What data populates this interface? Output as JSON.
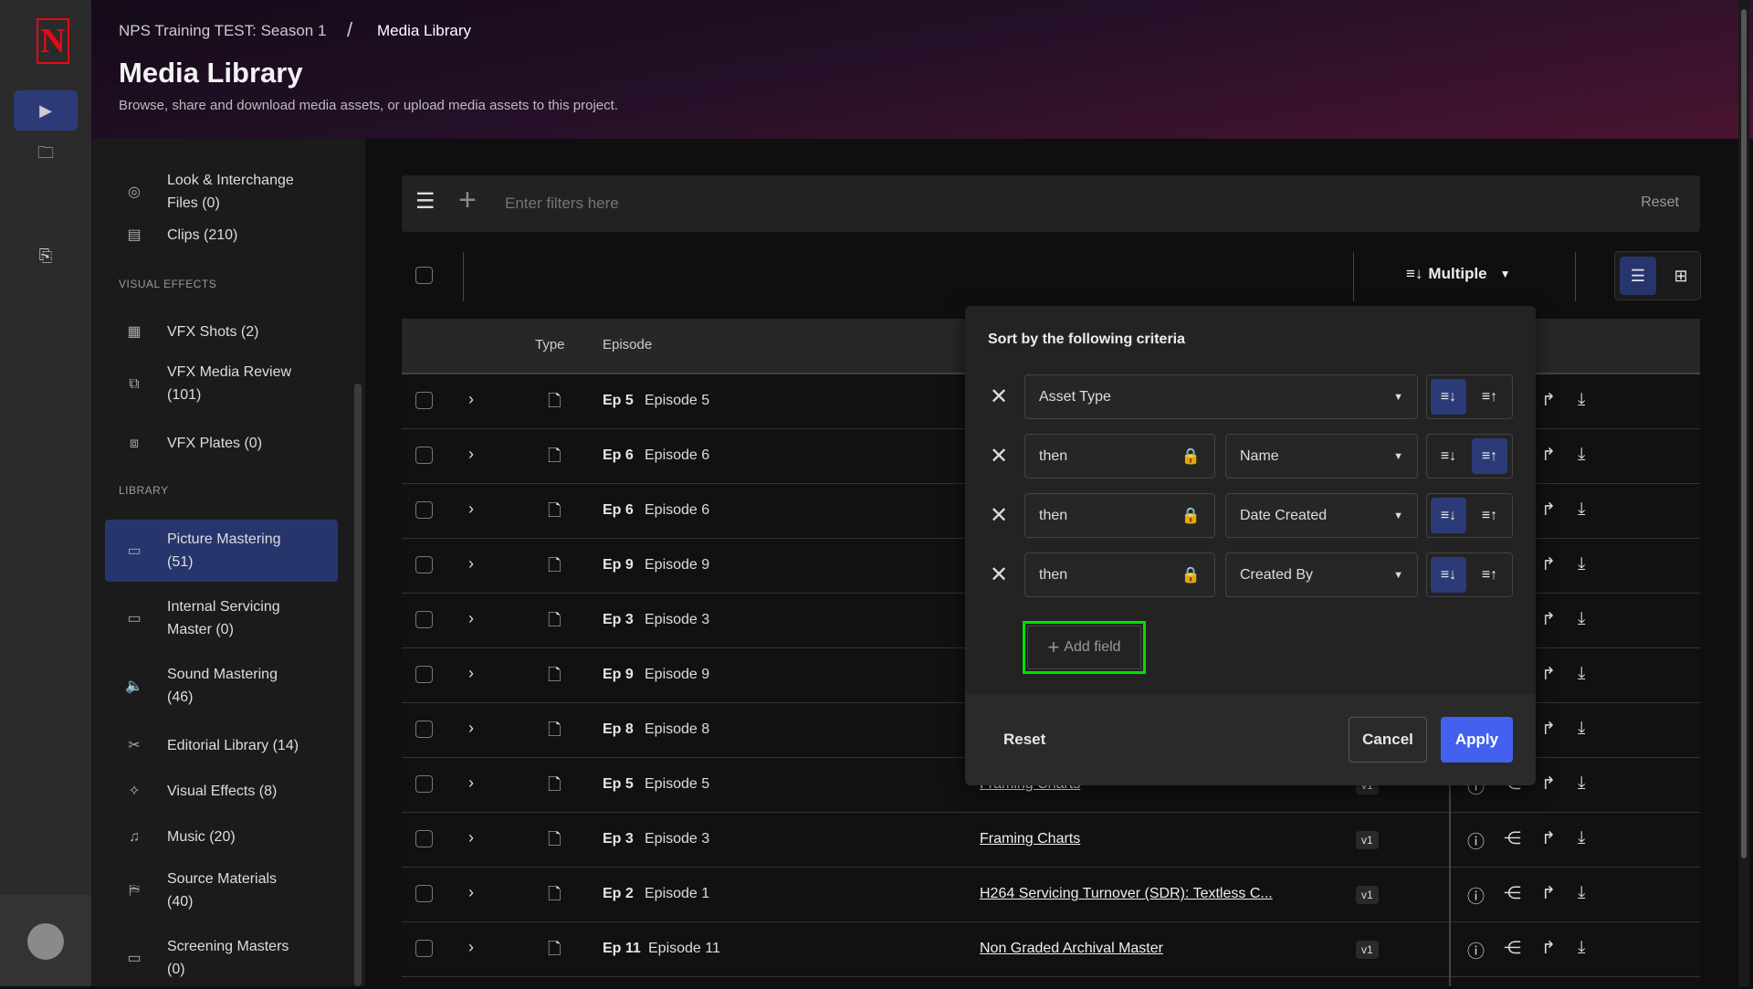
{
  "rail": {
    "logo": "N",
    "items": [
      "play-icon",
      "folder-icon",
      "export-icon"
    ],
    "active": 0
  },
  "header": {
    "breadcrumb": [
      "NPS Training TEST: Season 1",
      "Media Library"
    ],
    "separator": "/",
    "title": "Media Library",
    "subtitle": "Browse, share and download media assets, or upload media assets to this project."
  },
  "sidebar": {
    "items": [
      {
        "label": "Look & Interchange\nFiles (0)",
        "icon": "◎"
      },
      {
        "label": "Clips (210)",
        "icon": "▤"
      },
      {
        "section": "VISUAL EFFECTS"
      },
      {
        "label": "VFX Shots (2)",
        "icon": "▦"
      },
      {
        "label": "VFX Media Review\n(101)",
        "icon": "⧉"
      },
      {
        "label": "VFX Plates (0)",
        "icon": "⧈"
      },
      {
        "section": "LIBRARY"
      },
      {
        "label": "Picture Mastering\n(51)",
        "icon": "▭",
        "active": true
      },
      {
        "label": "Internal Servicing\nMaster (0)",
        "icon": "▭"
      },
      {
        "label": "Sound Mastering\n(46)",
        "icon": "🔈"
      },
      {
        "label": "Editorial Library (14)",
        "icon": "✂"
      },
      {
        "label": "Visual Effects (8)",
        "icon": "✧"
      },
      {
        "label": "Music (20)",
        "icon": "♫"
      },
      {
        "label": "Source Materials\n(40)",
        "icon": "⛿"
      },
      {
        "label": "Screening Masters\n(0)",
        "icon": "▭"
      }
    ]
  },
  "filter": {
    "placeholder": "Enter filters here",
    "reset": "Reset"
  },
  "toolbar": {
    "sort_label": "Multiple",
    "view": "list"
  },
  "table": {
    "headers": {
      "type": "Type",
      "episode": "Episode"
    },
    "rows": [
      {
        "ep": "Ep 5",
        "episode": "Episode 5",
        "name": "",
        "version": ""
      },
      {
        "ep": "Ep 6",
        "episode": "Episode 6",
        "name": "",
        "version": ""
      },
      {
        "ep": "Ep 6",
        "episode": "Episode 6",
        "name": "",
        "version": ""
      },
      {
        "ep": "Ep 9",
        "episode": "Episode 9",
        "name": "",
        "version": ""
      },
      {
        "ep": "Ep 3",
        "episode": "Episode 3",
        "name": "",
        "version": ""
      },
      {
        "ep": "Ep 9",
        "episode": "Episode 9",
        "name": "",
        "version": ""
      },
      {
        "ep": "Ep 8",
        "episode": "Episode 8",
        "name": "",
        "version": ""
      },
      {
        "ep": "Ep 5",
        "episode": "Episode 5",
        "name": "Framing Charts",
        "version": "v1"
      },
      {
        "ep": "Ep 3",
        "episode": "Episode 3",
        "name": "Framing Charts",
        "version": "v1"
      },
      {
        "ep": "Ep 2",
        "episode": "Episode 1",
        "name": "H264 Servicing Turnover (SDR): Textless C...",
        "version": "v1"
      },
      {
        "ep": "Ep 11",
        "episode": "Episode 11",
        "name": "Non Graded Archival Master",
        "version": "v1"
      }
    ]
  },
  "sort_popover": {
    "title": "Sort by the following criteria",
    "criteria": [
      {
        "prefix": "",
        "field": "Asset Type",
        "direction": "descending"
      },
      {
        "prefix": "then",
        "field": "Name",
        "direction": "ascending"
      },
      {
        "prefix": "then",
        "field": "Date Created",
        "direction": "descending"
      },
      {
        "prefix": "then",
        "field": "Created By",
        "direction": "descending"
      }
    ],
    "add_field": "Add field",
    "reset": "Reset",
    "cancel": "Cancel",
    "apply": "Apply"
  },
  "colors": {
    "accent": "#4361ee",
    "active_nav": "#27356d",
    "highlight": "#00e000",
    "logo": "#e50914"
  }
}
